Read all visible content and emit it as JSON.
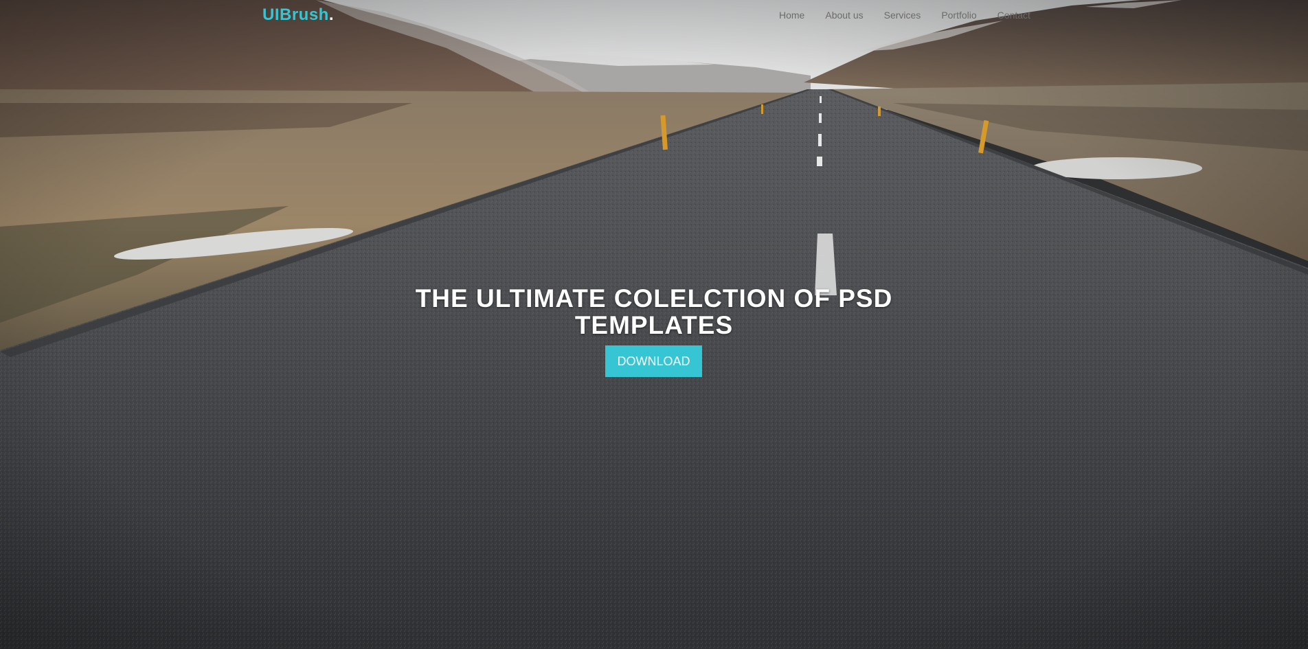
{
  "brand": {
    "name": "UIBrush",
    "dot": ".",
    "accent_color": "#36c6d3"
  },
  "nav": {
    "items": [
      {
        "label": "Home"
      },
      {
        "label": "About us"
      },
      {
        "label": "Services"
      },
      {
        "label": "Portfolio"
      },
      {
        "label": "Contact"
      }
    ]
  },
  "hero": {
    "headline": "THE ULTIMATE COLELCTION OF PSD TEMPLATES",
    "cta_label": "DOWNLOAD",
    "background": "road-landscape-photo"
  }
}
